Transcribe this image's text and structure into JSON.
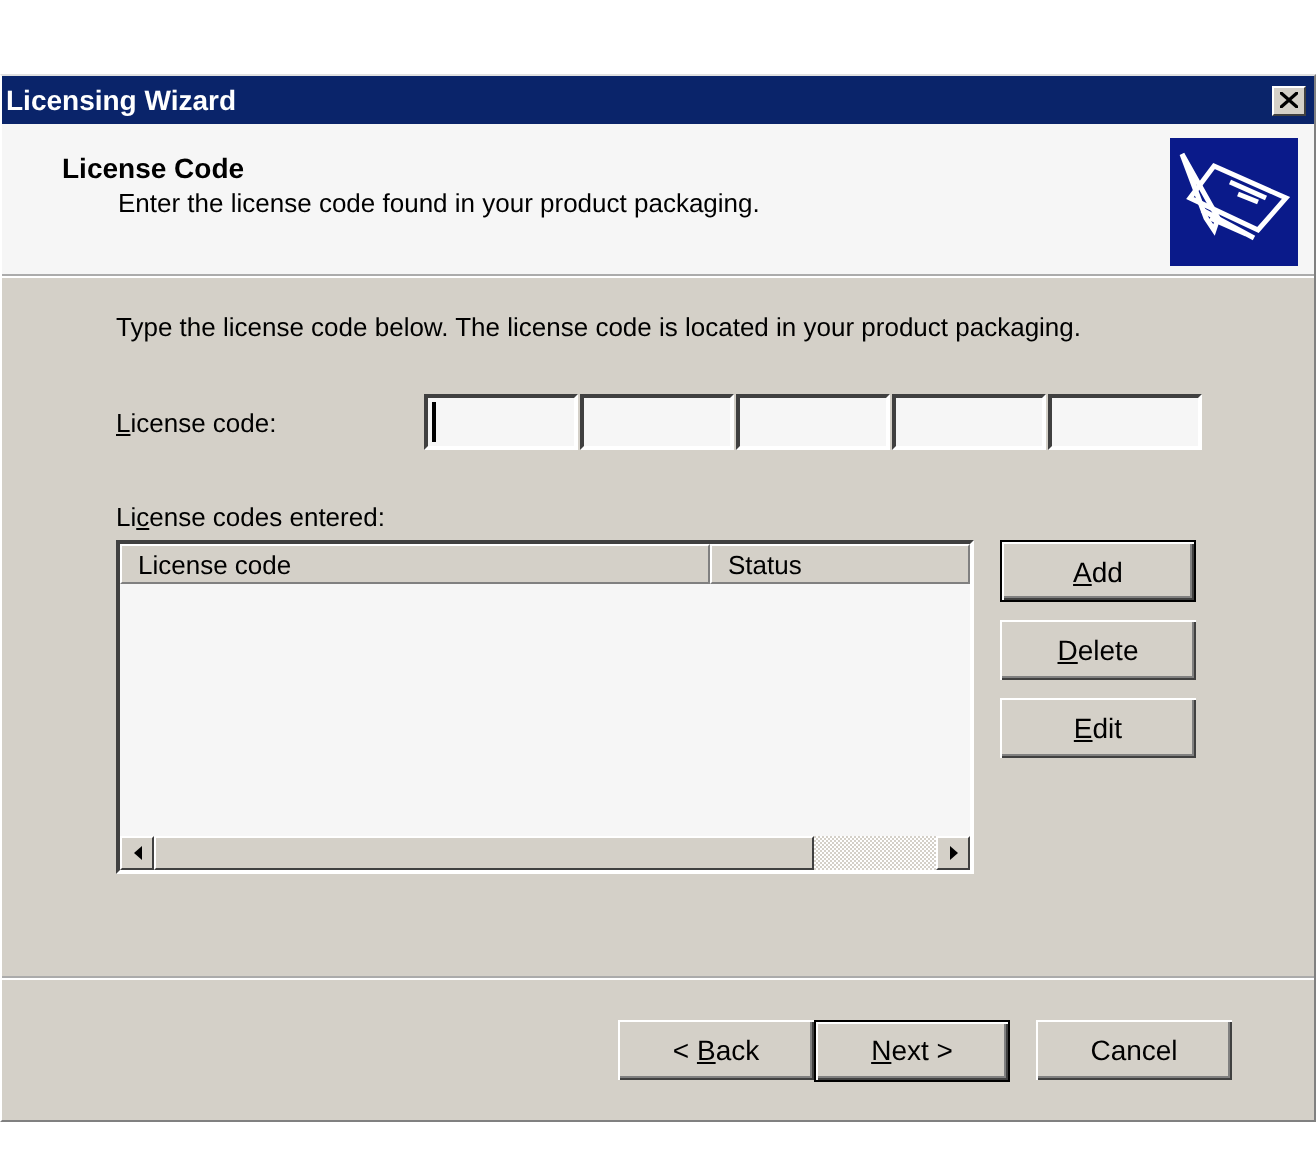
{
  "window": {
    "title": "Licensing Wizard"
  },
  "header": {
    "title": "License Code",
    "subtitle": "Enter the license code found in your product packaging."
  },
  "instruction": "Type the license code below. The license code is located in your product packaging.",
  "code_field": {
    "label": [
      {
        "text": "L",
        "underlined": true
      },
      {
        "text": "icense code:",
        "underlined": false
      }
    ],
    "segments": [
      {
        "focused": true
      },
      {
        "focused": false
      },
      {
        "focused": false
      },
      {
        "focused": false
      },
      {
        "focused": false
      }
    ]
  },
  "list": {
    "label": [
      {
        "text": "Li",
        "underlined": false
      },
      {
        "text": "c",
        "underlined": true
      },
      {
        "text": "ense codes entered:",
        "underlined": false
      }
    ],
    "columns": [
      "License code",
      "Status"
    ]
  },
  "side_buttons": [
    {
      "label": [
        {
          "text": "A",
          "underlined": true
        },
        {
          "text": "dd",
          "underlined": false
        }
      ],
      "default": true
    },
    {
      "label": [
        {
          "text": "D",
          "underlined": true
        },
        {
          "text": "elete",
          "underlined": false
        }
      ],
      "default": false
    },
    {
      "label": [
        {
          "text": "E",
          "underlined": true
        },
        {
          "text": "dit",
          "underlined": false
        }
      ],
      "default": false
    }
  ],
  "nav_buttons": [
    {
      "label": [
        {
          "text": "< ",
          "underlined": false
        },
        {
          "text": "B",
          "underlined": true
        },
        {
          "text": "ack",
          "underlined": false
        }
      ],
      "default": false
    },
    {
      "label": [
        {
          "text": "N",
          "underlined": true
        },
        {
          "text": "ext >",
          "underlined": false
        }
      ],
      "default": true
    },
    {
      "label": [
        {
          "text": "Cancel",
          "underlined": false
        }
      ],
      "default": false
    }
  ]
}
